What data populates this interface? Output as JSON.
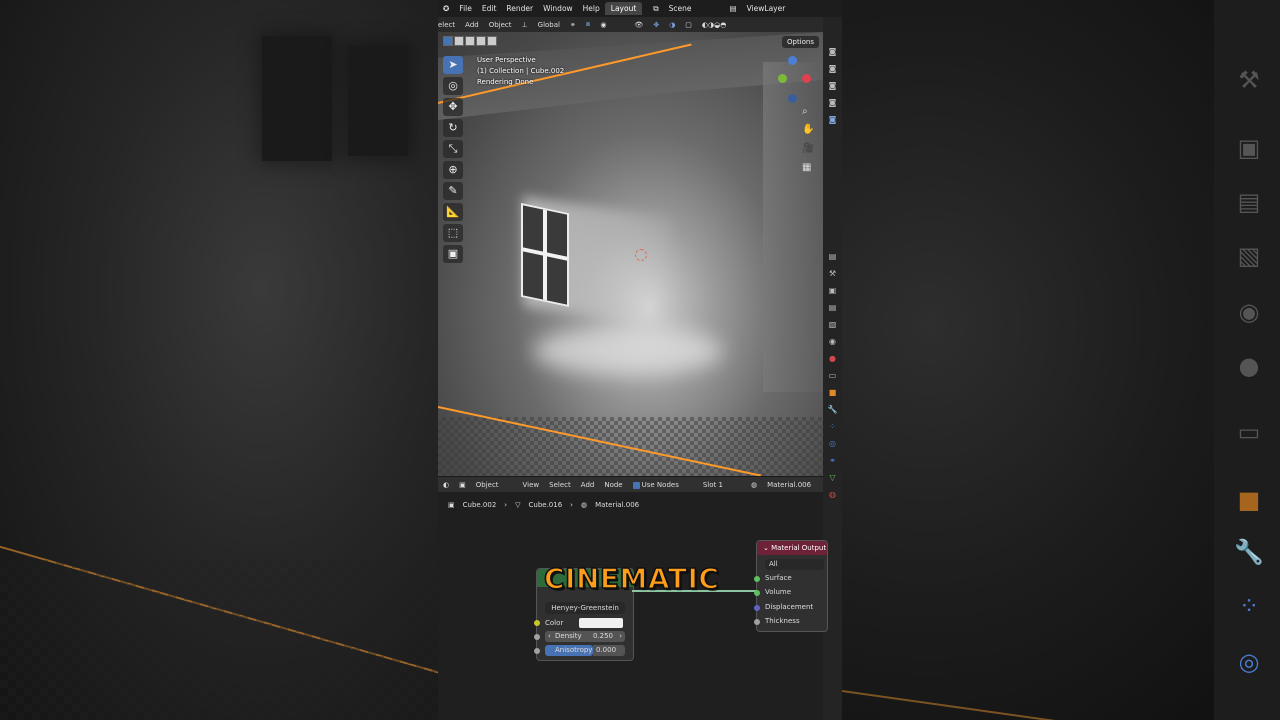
{
  "topbar": {
    "menus": [
      "File",
      "Edit",
      "Render",
      "Window",
      "Help"
    ],
    "active_tab": "Layout",
    "scene": "Scene",
    "view_layer": "ViewLayer"
  },
  "toolbar": {
    "items": [
      "elect",
      "Add",
      "Object"
    ],
    "orientation": "Global"
  },
  "viewport": {
    "options_label": "Options",
    "info_lines": [
      "User Perspective",
      "(1) Collection | Cube.002",
      "Rendering Done"
    ]
  },
  "node_header": {
    "object_mode": "Object",
    "menus": [
      "View",
      "Select",
      "Add",
      "Node"
    ],
    "use_nodes_label": "Use Nodes",
    "slot": "Slot 1",
    "material": "Material.006"
  },
  "breadcrumb": [
    "Cube.002",
    "Cube.016",
    "Material.006"
  ],
  "volume_node": {
    "phase": "Henyey-Greenstein",
    "color_label": "Color",
    "density_label": "Density",
    "density_value": "0.250",
    "anisotropy_label": "Anisotropy",
    "anisotropy_value": "0.000"
  },
  "output_node": {
    "title": "Material Output",
    "target": "All",
    "sockets": [
      "Surface",
      "Volume",
      "Displacement",
      "Thickness"
    ]
  },
  "overlay_caption": "CINEMATIC",
  "colors": {
    "accent_blue": "#4772b3",
    "caption_orange": "#ff9e1b",
    "selection_orange": "#ff9a2a",
    "output_header": "#6e2237"
  }
}
